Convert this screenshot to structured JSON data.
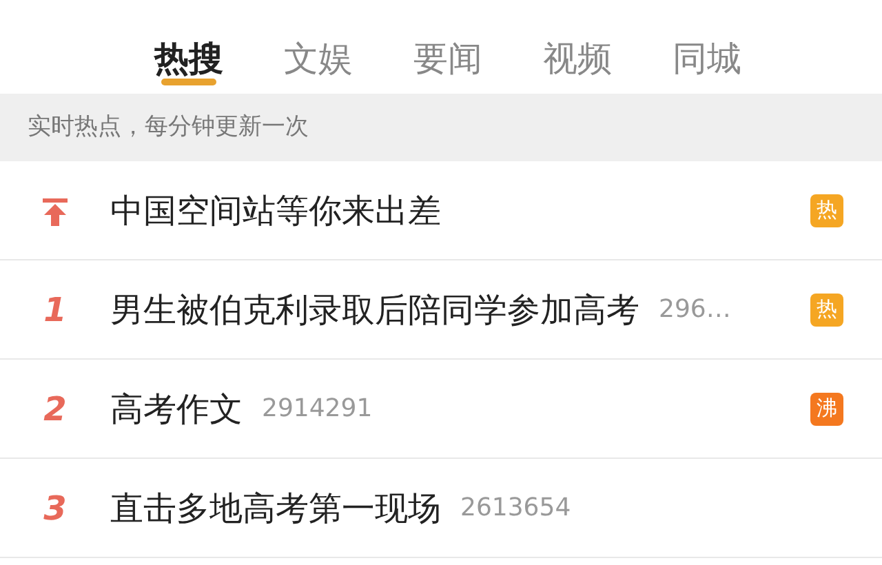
{
  "tabs": [
    {
      "label": "热搜",
      "selected": true
    },
    {
      "label": "文娱",
      "selected": false
    },
    {
      "label": "要闻",
      "selected": false
    },
    {
      "label": "视频",
      "selected": false
    },
    {
      "label": "同城",
      "selected": false
    }
  ],
  "notice": "实时热点，每分钟更新一次",
  "rows": [
    {
      "kind": "pinned",
      "title": "中国空间站等你来出差",
      "badge": {
        "label": "热",
        "color": "#f5a623"
      }
    },
    {
      "kind": "ranked",
      "rank": "1",
      "title": "男生被伯克利录取后陪同学参加高考",
      "count": "296…",
      "badge": {
        "label": "热",
        "color": "#f5a623"
      }
    },
    {
      "kind": "ranked",
      "rank": "2",
      "title": "高考作文",
      "count": "2914291",
      "badge": {
        "label": "沸",
        "color": "#f4781f"
      }
    },
    {
      "kind": "ranked",
      "rank": "3",
      "title": "直击多地高考第一现场",
      "count": "2613654"
    }
  ]
}
